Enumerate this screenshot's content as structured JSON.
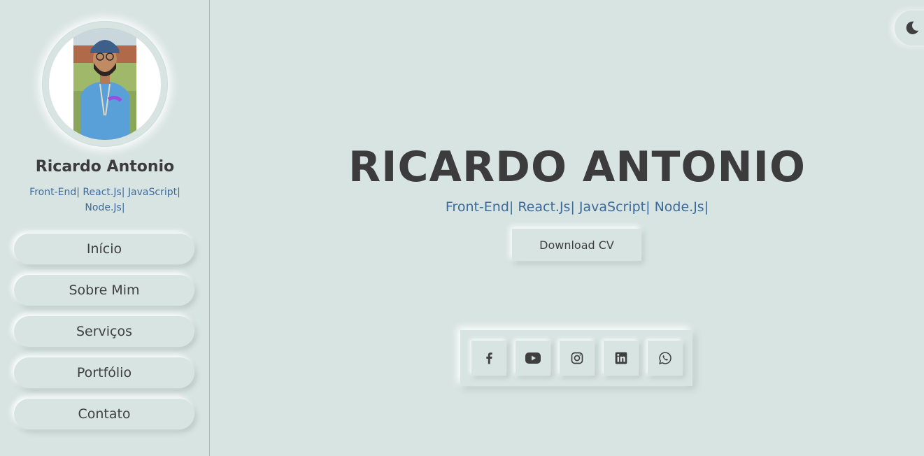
{
  "profile": {
    "name": "Ricardo Antonio",
    "tags_line1": "Front-End| React.Js| JavaScript|",
    "tags_line2": "Node.Js|"
  },
  "nav": {
    "items": [
      {
        "label": "Início"
      },
      {
        "label": "Sobre Mim"
      },
      {
        "label": "Serviços"
      },
      {
        "label": "Portfólio"
      },
      {
        "label": "Contato"
      }
    ]
  },
  "theme_toggle": {
    "icon": "moon-icon"
  },
  "hero": {
    "title": "RICARDO ANTONIO",
    "tags": "Front-End| React.Js| JavaScript| Node.Js|",
    "download_label": "Download CV"
  },
  "social": {
    "icons": [
      "facebook-icon",
      "youtube-icon",
      "instagram-icon",
      "linkedin-icon",
      "whatsapp-icon"
    ]
  },
  "colors": {
    "background": "#d8e4e2",
    "text": "#3f3f3f",
    "accent": "#3d6a99"
  }
}
